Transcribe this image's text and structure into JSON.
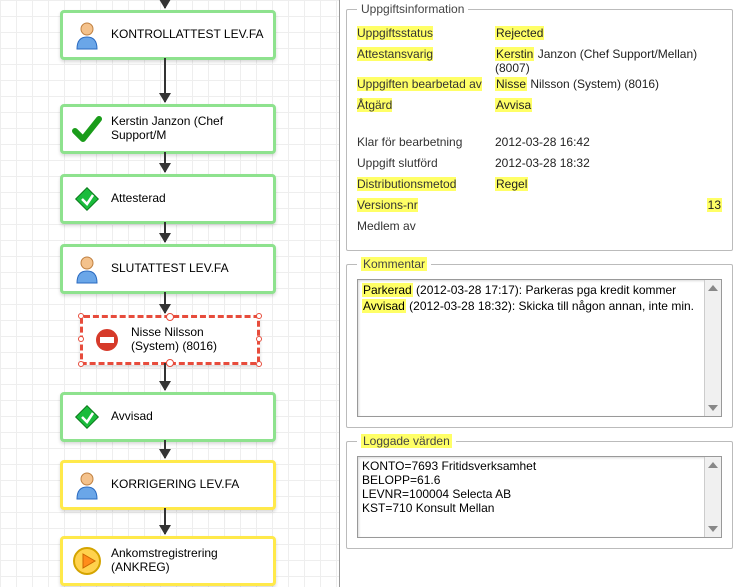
{
  "flow": {
    "nodes": [
      {
        "label": "KONTROLLATTEST LEV.FA",
        "icon": "user",
        "border": "green"
      },
      {
        "label": "Kerstin Janzon (Chef Support/M",
        "icon": "check",
        "border": "green"
      },
      {
        "label": "Attesterad",
        "icon": "diamond",
        "border": "green"
      },
      {
        "label": "SLUTATTEST LEV.FA",
        "icon": "user",
        "border": "green"
      },
      {
        "label": "Nisse Nilsson (System) (8016)",
        "icon": "stop",
        "border": "red"
      },
      {
        "label": "Avvisad",
        "icon": "diamond",
        "border": "green"
      },
      {
        "label": "KORRIGERING LEV.FA",
        "icon": "user",
        "border": "yellow"
      },
      {
        "label": "Ankomstregistrering (ANKREG)",
        "icon": "play",
        "border": "yellow"
      }
    ]
  },
  "info": {
    "groupTitle": "Uppgiftsinformation",
    "rows": [
      {
        "label": "Uppgiftsstatus",
        "value": "Rejected",
        "hlLabel": true,
        "hlValue": true
      },
      {
        "label": "Attestansvarig",
        "value": "Kerstin Janzon (Chef Support/Mellan) (8007)",
        "hlLabel": true,
        "hlValuePrefix": "Kerstin"
      },
      {
        "label": "Uppgiften bearbetad av",
        "value": "Nisse Nilsson (System) (8016)",
        "hlLabel": true,
        "hlValuePrefix": "Nisse"
      },
      {
        "label": "Åtgärd",
        "value": "Avvisa",
        "hlLabel": true,
        "hlValue": true
      },
      {
        "spacer": true
      },
      {
        "label": "Klar för bearbetning",
        "value": "2012-03-28 16:42"
      },
      {
        "label": "Uppgift slutförd",
        "value": "2012-03-28 18:32"
      },
      {
        "label": "Distributionsmetod",
        "value": "Regel",
        "hlLabel": true,
        "hlValue": true
      },
      {
        "label": "Versions-nr",
        "value": "13",
        "hlLabel": true,
        "hlValue": true,
        "alignRight": true
      },
      {
        "label": "Medlem av",
        "value": ""
      }
    ]
  },
  "comment": {
    "title": "Kommentar",
    "entries": [
      {
        "status": "Parkerad",
        "meta": "(2012-03-28 17:17): Parkeras pga kredit kommer"
      },
      {
        "status": "Avvisad",
        "meta": "(2012-03-28 18:32): Skicka till någon annan, inte min."
      }
    ]
  },
  "log": {
    "title": "Loggade värden",
    "lines": [
      "KONTO=7693 Fritidsverksamhet",
      "BELOPP=61.6",
      "LEVNR=100004 Selecta AB",
      "KST=710 Konsult Mellan"
    ]
  }
}
